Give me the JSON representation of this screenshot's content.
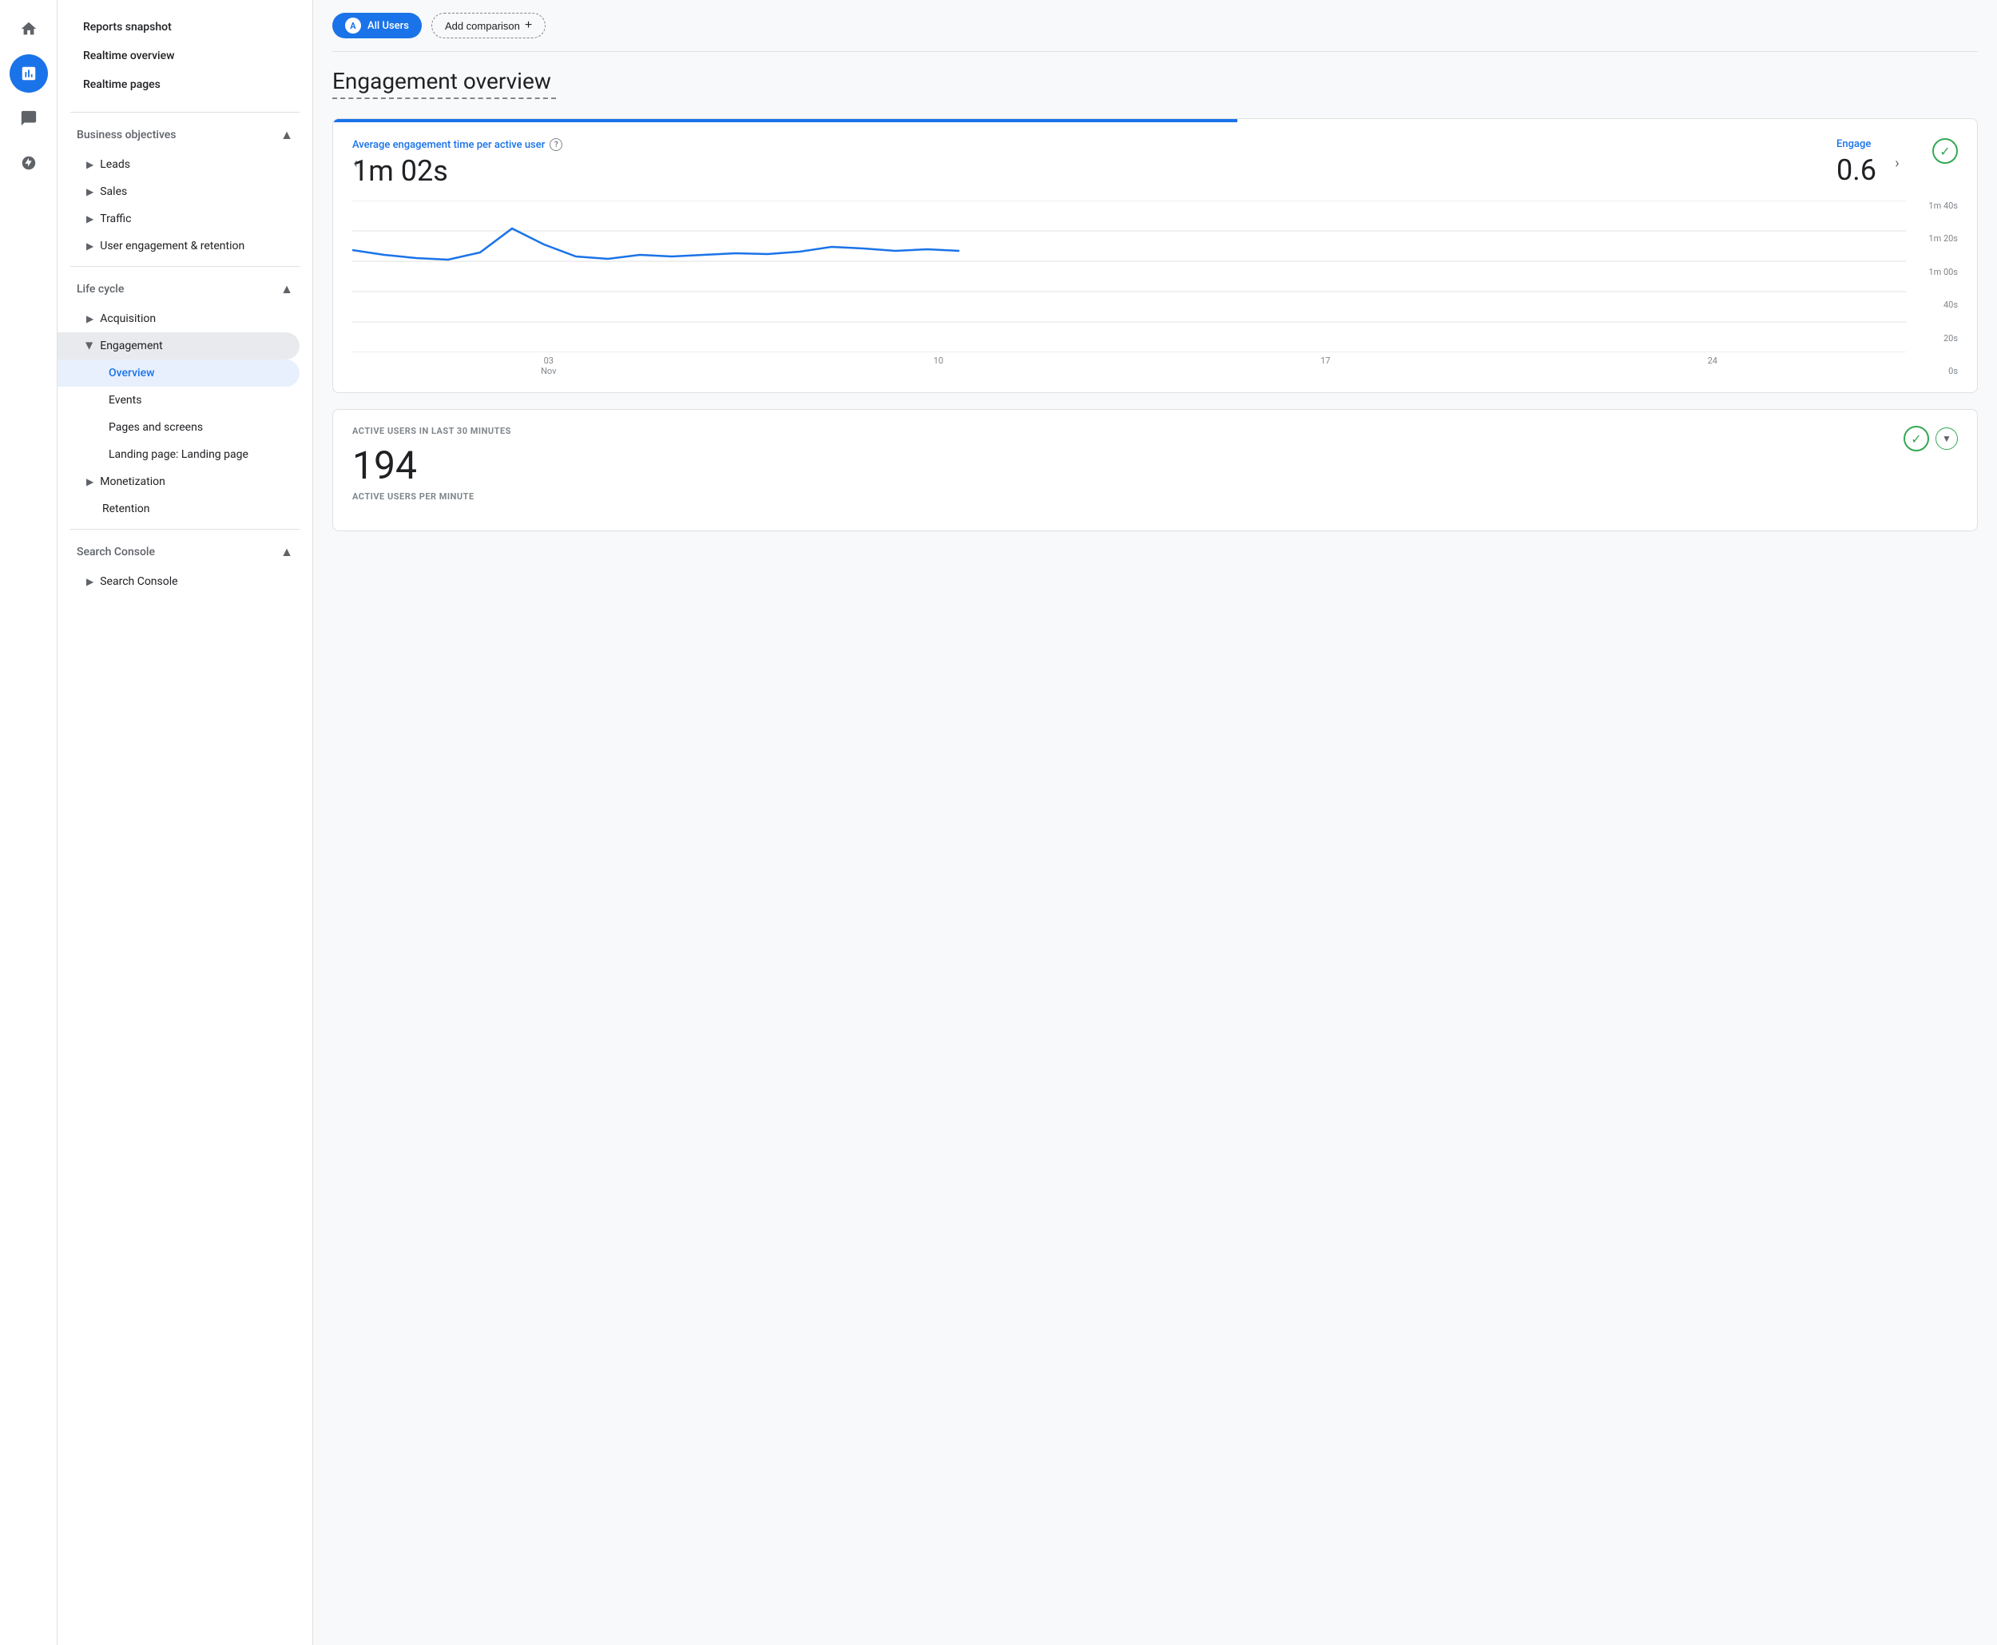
{
  "iconSidebar": {
    "items": [
      {
        "name": "home-icon",
        "icon": "⌂",
        "active": false
      },
      {
        "name": "analytics-icon",
        "icon": "📊",
        "active": true
      },
      {
        "name": "chat-icon",
        "icon": "💬",
        "active": false
      },
      {
        "name": "assistant-icon",
        "icon": "🔊",
        "active": false
      }
    ]
  },
  "navSidebar": {
    "topItems": [
      {
        "name": "reports-snapshot",
        "label": "Reports snapshot"
      },
      {
        "name": "realtime-overview",
        "label": "Realtime overview"
      },
      {
        "name": "realtime-pages",
        "label": "Realtime pages"
      }
    ],
    "sections": [
      {
        "name": "business-objectives",
        "label": "Business objectives",
        "expanded": true,
        "items": [
          {
            "name": "leads",
            "label": "Leads",
            "hasArrow": true
          },
          {
            "name": "sales",
            "label": "Sales",
            "hasArrow": true
          },
          {
            "name": "traffic",
            "label": "Traffic",
            "hasArrow": true
          },
          {
            "name": "user-engagement",
            "label": "User engagement & retention",
            "hasArrow": true
          }
        ]
      },
      {
        "name": "life-cycle",
        "label": "Life cycle",
        "expanded": true,
        "items": [
          {
            "name": "acquisition",
            "label": "Acquisition",
            "hasArrow": true,
            "expanded": false
          },
          {
            "name": "engagement",
            "label": "Engagement",
            "hasArrow": true,
            "expanded": true,
            "subItems": [
              {
                "name": "overview",
                "label": "Overview",
                "active": true
              },
              {
                "name": "events",
                "label": "Events",
                "active": false
              },
              {
                "name": "pages-and-screens",
                "label": "Pages and screens",
                "active": false
              },
              {
                "name": "landing-page",
                "label": "Landing page: Landing page",
                "active": false
              }
            ]
          },
          {
            "name": "monetization",
            "label": "Monetization",
            "hasArrow": true
          },
          {
            "name": "retention",
            "label": "Retention",
            "hasArrow": false
          }
        ]
      },
      {
        "name": "search-console-section",
        "label": "Search Console",
        "expanded": true,
        "items": [
          {
            "name": "search-console-item",
            "label": "Search Console",
            "hasArrow": true
          }
        ]
      }
    ]
  },
  "mainContent": {
    "topBar": {
      "segment": {
        "avatar": "A",
        "label": "All Users"
      },
      "addComparison": "Add comparison"
    },
    "pageTitle": "Engagement overview",
    "metricCard": {
      "topBarWidth": "55%",
      "metric1": {
        "label": "Average engagement time per active user",
        "value": "1m 02s"
      },
      "metric2": {
        "label": "Engage",
        "value": "0.6"
      },
      "chartData": {
        "yLabels": [
          "1m 40s",
          "1m 20s",
          "1m 00s",
          "40s",
          "20s",
          "0s"
        ],
        "xLabels": [
          {
            "line1": "03",
            "line2": "Nov"
          },
          {
            "line1": "10",
            "line2": ""
          },
          {
            "line1": "17",
            "line2": ""
          },
          {
            "line1": "24",
            "line2": ""
          }
        ],
        "points": [
          [
            0,
            58
          ],
          [
            30,
            55
          ],
          [
            60,
            53
          ],
          [
            90,
            52
          ],
          [
            120,
            56
          ],
          [
            150,
            75
          ],
          [
            180,
            65
          ],
          [
            210,
            55
          ],
          [
            240,
            52
          ],
          [
            270,
            54
          ],
          [
            300,
            53
          ],
          [
            330,
            54
          ],
          [
            360,
            55
          ],
          [
            390,
            54
          ],
          [
            420,
            56
          ],
          [
            450,
            58
          ],
          [
            480,
            57
          ],
          [
            510,
            56
          ],
          [
            540,
            57
          ]
        ]
      }
    },
    "activeUsersCard": {
      "sectionLabel": "ACTIVE USERS IN LAST 30 MINUTES",
      "value": "194",
      "perMinuteLabel": "ACTIVE USERS PER MINUTE"
    }
  }
}
